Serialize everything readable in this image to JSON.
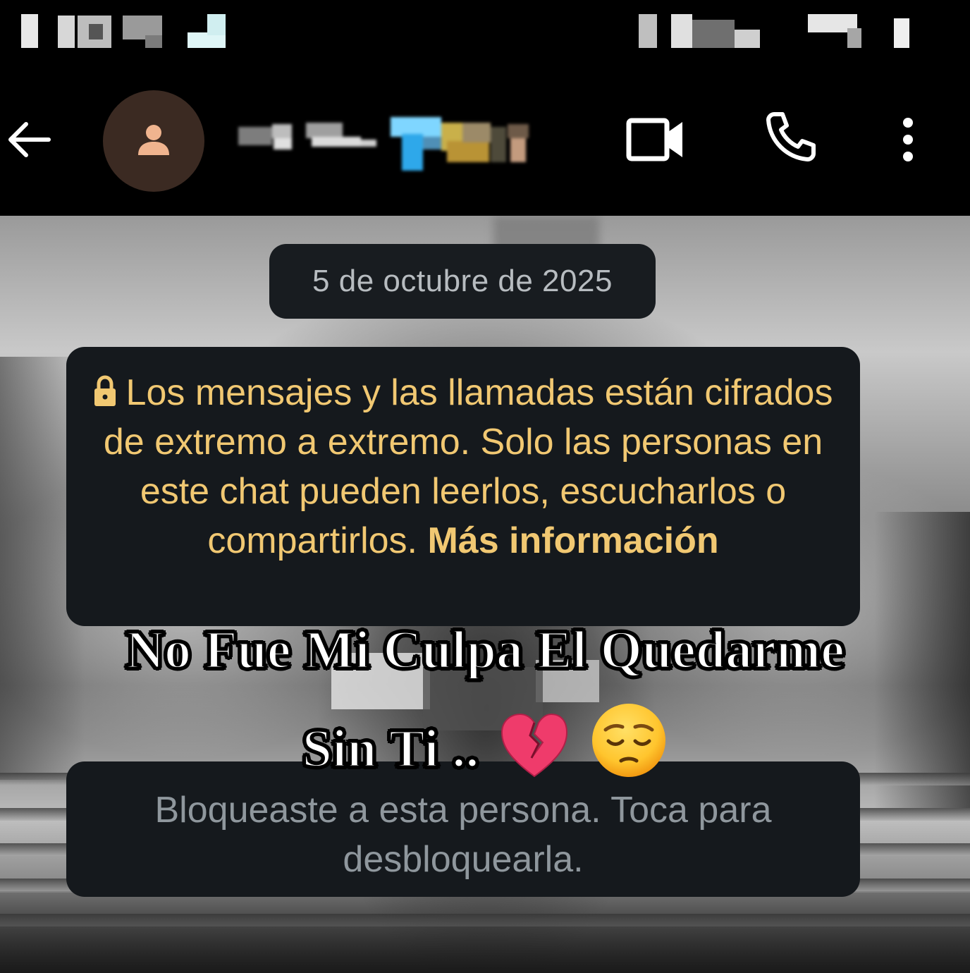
{
  "chat": {
    "date_chip": "5 de octubre de 2025",
    "encryption_notice": {
      "text": "Los mensajes y las llamadas están cifrados de extremo a extremo. Solo las personas en este chat pueden leerlos, escucharlos o compartirlos.",
      "link": "Más información"
    },
    "block_notice": "Bloqueaste a esta persona. Toca para desbloquearla."
  },
  "caption": {
    "line1": "No Fue Mi Culpa El Quedarme",
    "line2": "Sin Ti .."
  },
  "icons": {
    "back": "arrow-left-icon",
    "avatar": "person-icon",
    "video_call": "video-camera-icon",
    "voice_call": "phone-icon",
    "menu": "more-vertical-icon",
    "lock": "lock-icon",
    "broken_heart": "broken-heart-emoji",
    "pensive_face": "pensive-face-emoji"
  },
  "colors": {
    "notice_text": "#f1c872",
    "bubble_bg": "#15191d",
    "date_text": "#b7bcc0",
    "block_text": "#8f979d",
    "avatar_bg": "#3b2a22",
    "avatar_fg": "#f0b48f"
  }
}
